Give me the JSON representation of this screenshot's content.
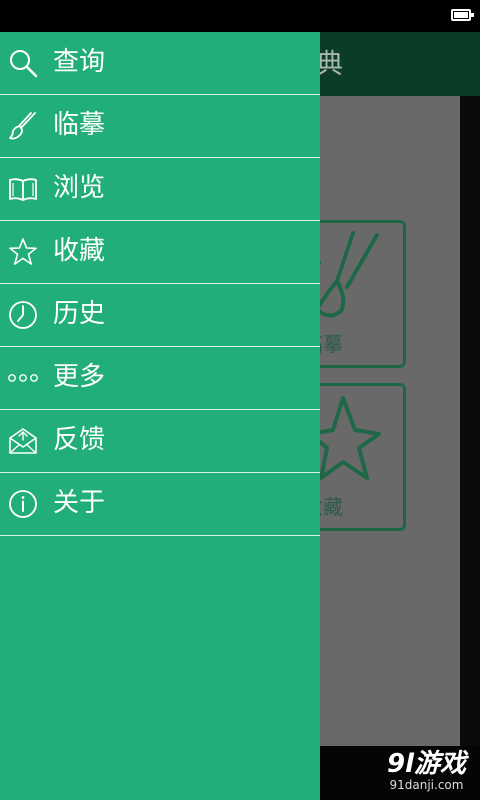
{
  "background_app": {
    "title_partial": "典",
    "tiles": [
      {
        "label_partial": "临摹",
        "icon": "brush-icon"
      },
      {
        "label_partial": "收藏",
        "icon": "star-icon"
      }
    ]
  },
  "drawer": {
    "items": [
      {
        "label": "查询",
        "icon": "search-icon"
      },
      {
        "label": "临摹",
        "icon": "brush-icon"
      },
      {
        "label": "浏览",
        "icon": "book-icon"
      },
      {
        "label": "收藏",
        "icon": "star-icon"
      },
      {
        "label": "历史",
        "icon": "clock-icon"
      },
      {
        "label": "更多",
        "icon": "more-icon"
      },
      {
        "label": "反馈",
        "icon": "mail-icon"
      },
      {
        "label": "关于",
        "icon": "info-icon"
      }
    ]
  },
  "watermark": {
    "logo": "9l游戏",
    "url": "91danji.com"
  },
  "colors": {
    "drawer_bg": "#22ae78",
    "header_bg": "#0b3c26",
    "content_overlay": "#696969",
    "tile_border": "#1e6848"
  }
}
